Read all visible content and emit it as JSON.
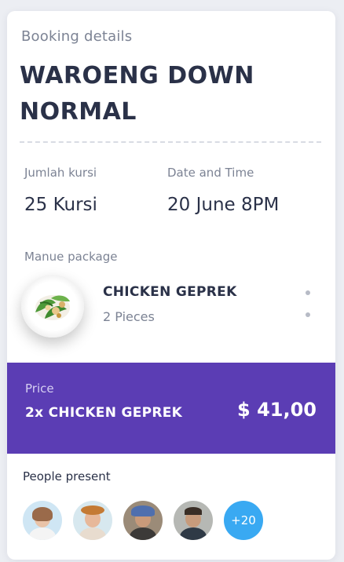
{
  "booking": {
    "section_label": "Booking details",
    "title": "WAROENG DOWN NORMAL"
  },
  "details": {
    "seats_label": "Jumlah kursi",
    "seats_value": "25 Kursi",
    "datetime_label": "Date and Time",
    "datetime_value": "20 June 8PM"
  },
  "package": {
    "label": "Manue package",
    "name": "CHICKEN GEPREK",
    "quantity": "2 Pieces",
    "image_icon": "food-plate-image",
    "menu_icon": "vertical-dots-icon"
  },
  "price": {
    "label": "Price",
    "item": "2x CHICKEN GEPREK",
    "total": "$ 41,00"
  },
  "people": {
    "label": "People present",
    "avatars": [
      "avatar-1",
      "avatar-2",
      "avatar-3",
      "avatar-4"
    ],
    "more_count": "+20"
  },
  "colors": {
    "accent": "#5b3db4",
    "text_dark": "#2a3148",
    "text_muted": "#7c8394",
    "badge": "#39a9f2"
  }
}
